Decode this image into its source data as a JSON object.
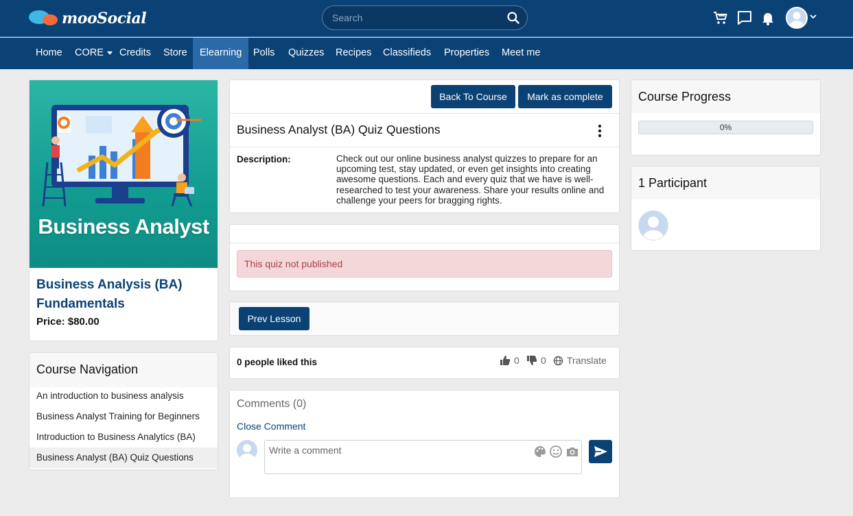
{
  "header": {
    "logo_text": "mooSocial",
    "search_placeholder": "Search"
  },
  "nav": {
    "items": [
      {
        "label": "Home"
      },
      {
        "label": "CORE"
      },
      {
        "label": "Credits"
      },
      {
        "label": "Store"
      },
      {
        "label": "Elearning"
      },
      {
        "label": "Polls"
      },
      {
        "label": "Quizzes"
      },
      {
        "label": "Recipes"
      },
      {
        "label": "Classifieds"
      },
      {
        "label": "Properties"
      },
      {
        "label": "Meet me"
      }
    ]
  },
  "course": {
    "image_caption": "Business Analyst",
    "title": "Business Analysis (BA) Fundamentals",
    "price": "Price: $80.00"
  },
  "course_navigation": {
    "title": "Course Navigation",
    "lessons": [
      {
        "label": "An introduction to business analysis"
      },
      {
        "label": "Business Analyst Training for Beginners"
      },
      {
        "label": "Introduction to Business Analytics (BA)"
      },
      {
        "label": "Business Analyst (BA) Quiz Questions"
      }
    ]
  },
  "lesson": {
    "back_button": "Back To Course",
    "complete_button": "Mark as complete",
    "title": "Business Analyst (BA) Quiz Questions",
    "description_label": "Description:",
    "description": "Check out our online business analyst quizzes to prepare for an upcoming test, stay updated, or even get insights into creating awesome questions. Each and every quiz that we have is well-researched to test your awareness. Share your results online and challenge your peers for bragging rights.",
    "alert": "This quiz not published",
    "prev_button": "Prev Lesson"
  },
  "likes": {
    "text": "0 people liked this",
    "like_count": "0",
    "dislike_count": "0",
    "translate": "Translate"
  },
  "comments": {
    "title": "Comments (0)",
    "close": "Close Comment",
    "placeholder": "Write a comment"
  },
  "progress": {
    "title": "Course Progress",
    "value_label": "0%",
    "value": 0
  },
  "participants": {
    "title": "1 Participant"
  },
  "colors": {
    "primary": "#0b4276",
    "nav_active": "#2b6aa7",
    "alert_bg": "#f3d7d9",
    "alert_text": "#a94442"
  }
}
